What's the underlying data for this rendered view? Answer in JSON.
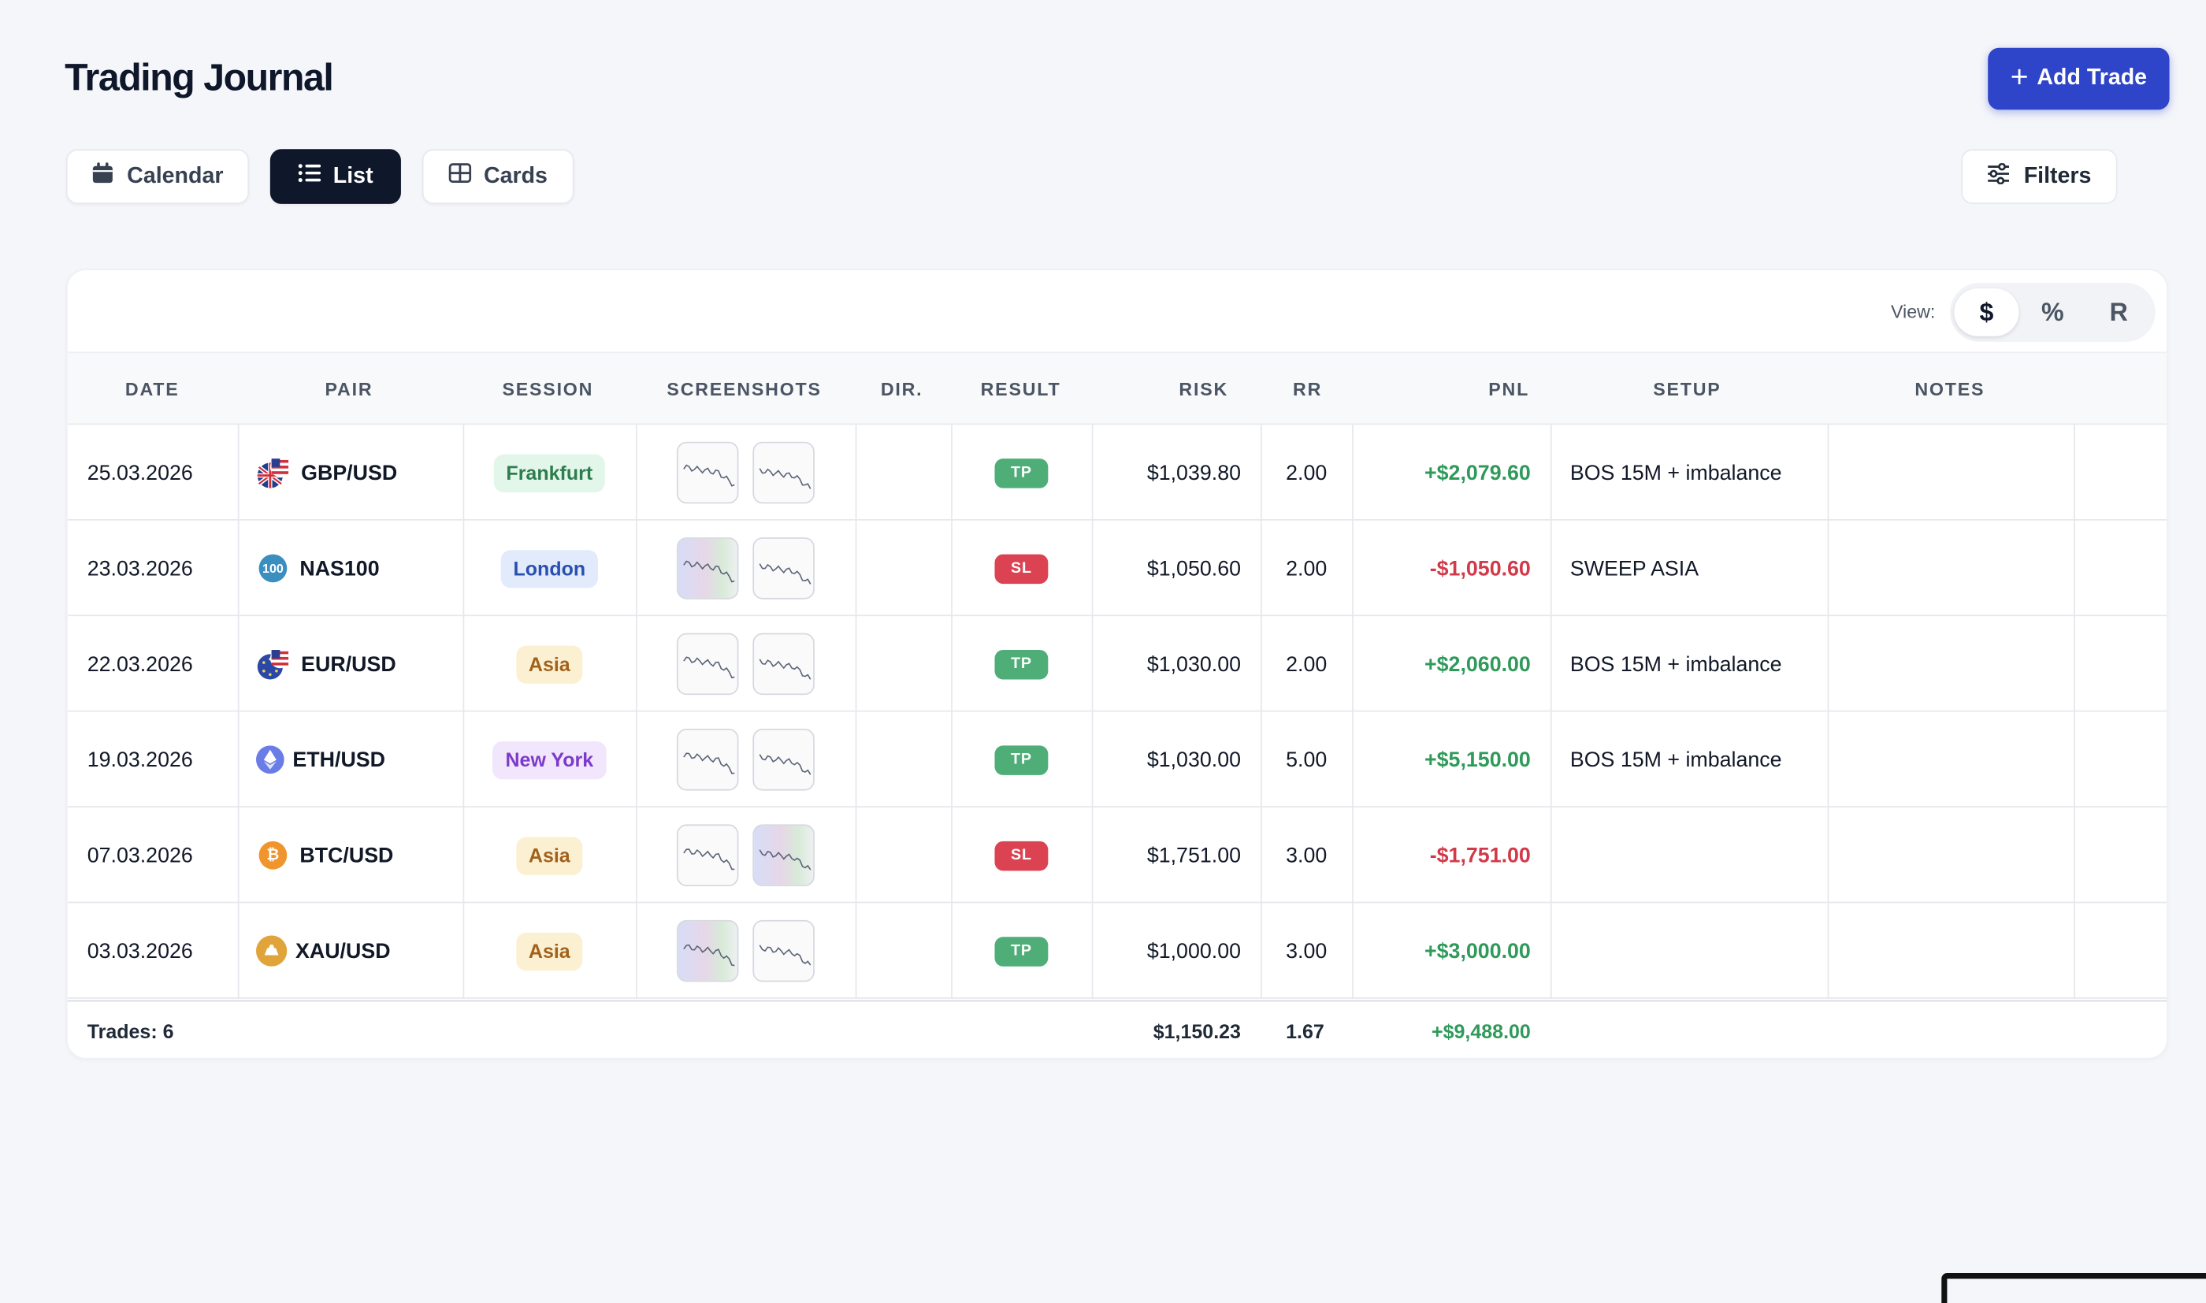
{
  "header": {
    "title": "Trading Journal",
    "add_label": "Add Trade",
    "add_plus": "+"
  },
  "view_tabs": [
    {
      "label": "Calendar",
      "icon": "calendar-icon"
    },
    {
      "label": "List",
      "icon": "list-icon",
      "active": true
    },
    {
      "label": "Cards",
      "icon": "grid-icon"
    }
  ],
  "filters_label": "Filters",
  "display": {
    "label": "View:",
    "options": [
      "$",
      "%",
      "R"
    ],
    "selected": "$"
  },
  "columns": [
    "Date",
    "Pair",
    "Session",
    "Screenshots",
    "Dir.",
    "Result",
    "Risk",
    "RR",
    "PNL",
    "Setup",
    "Notes"
  ],
  "trades": [
    {
      "date": "25.03.2026",
      "pair": "GBP/USD",
      "pair_icon": "gbp-usd-flag-icon",
      "session": "Frankfurt",
      "result": "TP",
      "risk": "$1,039.80",
      "rr": "2.00",
      "pnl": "+$2,079.60",
      "setup": "BOS 15M + imbalance",
      "notes": ""
    },
    {
      "date": "23.03.2026",
      "pair": "NAS100",
      "pair_icon": "nas100-icon",
      "pair_icon_text": "100",
      "session": "London",
      "result": "SL",
      "risk": "$1,050.60",
      "rr": "2.00",
      "pnl": "-$1,050.60",
      "setup": "SWEEP ASIA",
      "notes": ""
    },
    {
      "date": "22.03.2026",
      "pair": "EUR/USD",
      "pair_icon": "eur-usd-flag-icon",
      "session": "Asia",
      "result": "TP",
      "risk": "$1,030.00",
      "rr": "2.00",
      "pnl": "+$2,060.00",
      "setup": "BOS 15M + imbalance",
      "notes": ""
    },
    {
      "date": "19.03.2026",
      "pair": "ETH/USD",
      "pair_icon": "ethereum-icon",
      "session": "New York",
      "result": "TP",
      "risk": "$1,030.00",
      "rr": "5.00",
      "pnl": "+$5,150.00",
      "setup": "BOS 15M + imbalance",
      "notes": ""
    },
    {
      "date": "07.03.2026",
      "pair": "BTC/USD",
      "pair_icon": "bitcoin-icon",
      "pair_icon_text": "₿",
      "session": "Asia",
      "result": "SL",
      "risk": "$1,751.00",
      "rr": "3.00",
      "pnl": "-$1,751.00",
      "setup": "",
      "notes": ""
    },
    {
      "date": "03.03.2026",
      "pair": "XAU/USD",
      "pair_icon": "gold-icon",
      "session": "Asia",
      "result": "TP",
      "risk": "$1,000.00",
      "rr": "3.00",
      "pnl": "+$3,000.00",
      "setup": "",
      "notes": ""
    }
  ],
  "footer": {
    "trades_label": "Trades: 6",
    "avg_risk": "$1,150.23",
    "avg_rr": "1.67",
    "total_pnl": "+$9,488.00"
  },
  "colors": {
    "accent": "#2e44c9",
    "profit": "#2f9a5a",
    "loss": "#d23a4a",
    "tp_badge": "#4fae78",
    "sl_badge": "#dc4352",
    "session_frankfurt": "#e3f6ea",
    "session_london": "#e2ebfb",
    "session_asia": "#fbf0d2",
    "session_newyork": "#f1e6fb"
  }
}
